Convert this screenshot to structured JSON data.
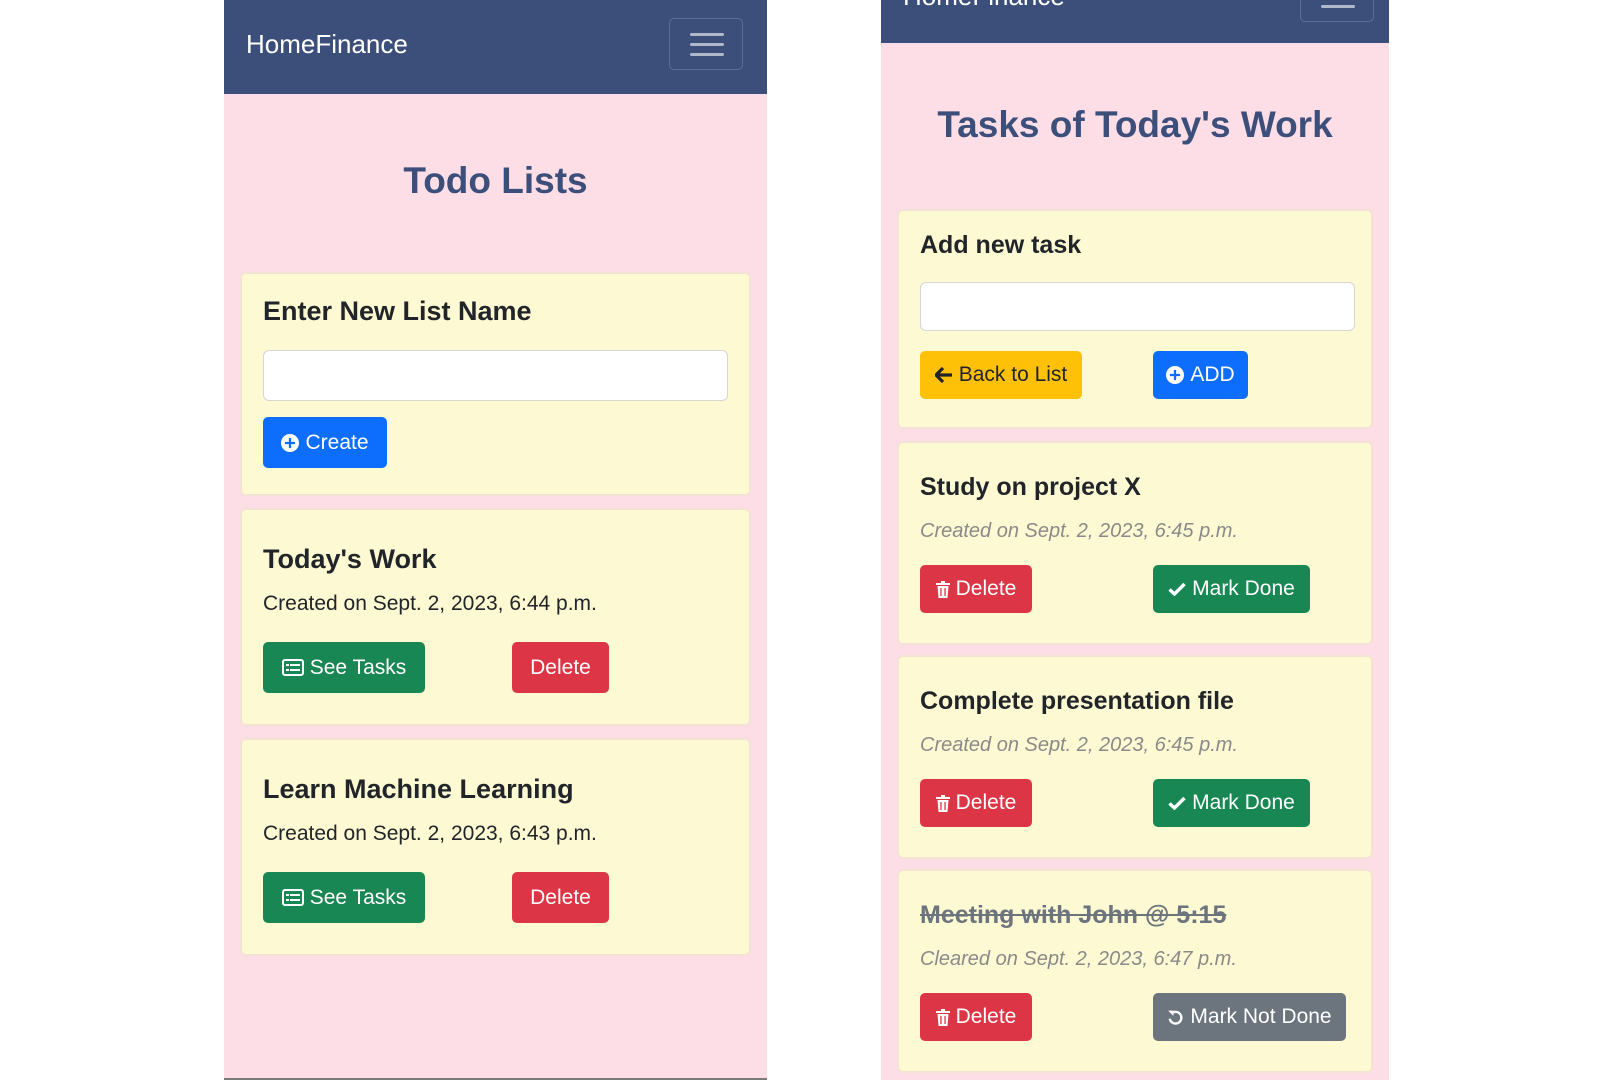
{
  "left_screen": {
    "navbar": {
      "brand": "HomeFinance",
      "menu_icon": "hamburger-icon"
    },
    "page_title": "Todo Lists",
    "new_list_card": {
      "heading": "Enter New List Name",
      "input_value": "",
      "create_label": "Create"
    },
    "lists": [
      {
        "name": "Today's Work",
        "created": "Created on Sept. 2, 2023, 6:44 p.m.",
        "see_tasks_label": "See Tasks",
        "delete_label": "Delete"
      },
      {
        "name": "Learn Machine Learning",
        "created": "Created on Sept. 2, 2023, 6:43 p.m.",
        "see_tasks_label": "See Tasks",
        "delete_label": "Delete"
      }
    ]
  },
  "right_screen": {
    "navbar": {
      "brand": "HomeFinance",
      "menu_icon": "hamburger-icon"
    },
    "page_title": "Tasks of Today's Work",
    "add_task_card": {
      "heading": "Add new task",
      "input_value": "",
      "back_label": "Back to List",
      "add_label": "ADD"
    },
    "tasks": [
      {
        "name": "Study on project X",
        "timestamp": "Created on Sept. 2, 2023, 6:45 p.m.",
        "delete_label": "Delete",
        "toggle_label": "Mark Done",
        "done": false
      },
      {
        "name": "Complete presentation file",
        "timestamp": "Created on Sept. 2, 2023, 6:45 p.m.",
        "delete_label": "Delete",
        "toggle_label": "Mark Done",
        "done": false
      },
      {
        "name": "Meeting with John @ 5:15",
        "timestamp": "Cleared on Sept. 2, 2023, 6:47 p.m.",
        "delete_label": "Delete",
        "toggle_label": "Mark Not Done",
        "done": true
      }
    ]
  },
  "colors": {
    "navbar": "#3c4f7a",
    "page_background": "#fddde6",
    "card_background": "#fdf9d3",
    "title": "#3c4f7a",
    "primary": "#0d6efd",
    "success": "#198754",
    "danger": "#dc3545",
    "warning": "#ffc107",
    "secondary": "#6c757d"
  }
}
